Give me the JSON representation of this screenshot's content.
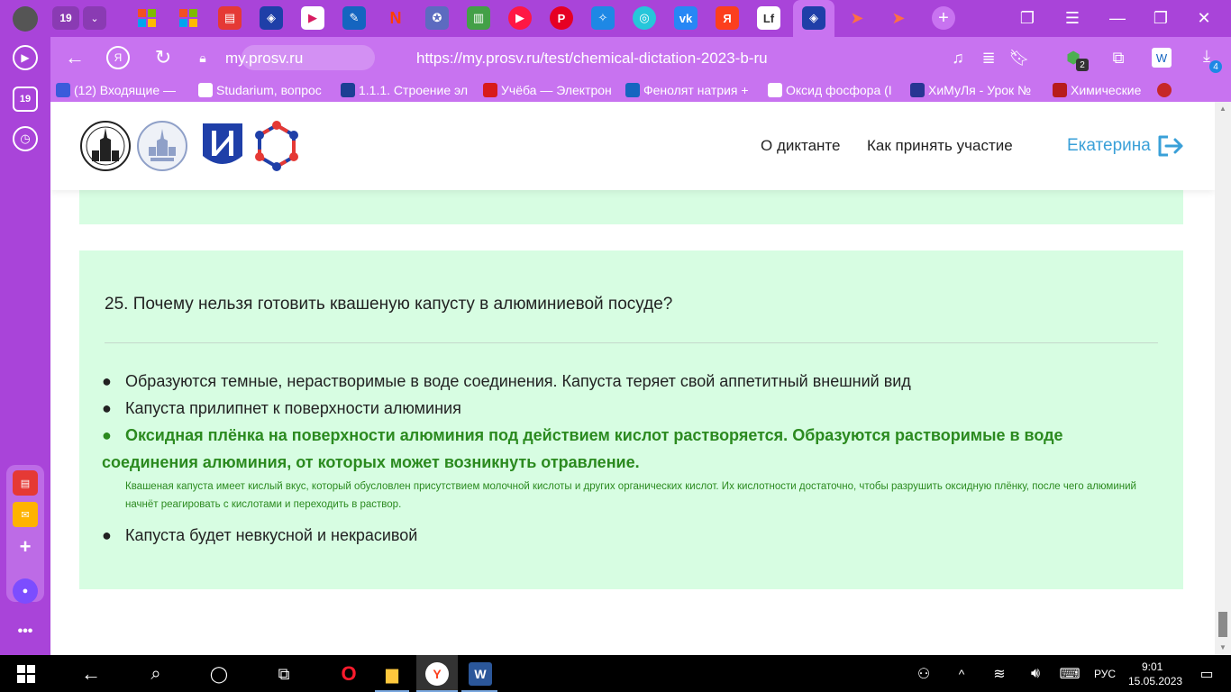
{
  "browser": {
    "tab_counter": "19",
    "sidebar_counter": "19",
    "url_domain": "my.prosv.ru",
    "url_full": "https://my.prosv.ru/test/chemical-dictation-2023-b-ru",
    "badge_downloads": "4",
    "badge_extension": "2",
    "accent_color": "#a944d9",
    "bookmarks": [
      {
        "label": "(12) Входящие — ",
        "icon": "mail-icon",
        "color": "#3b5bdb"
      },
      {
        "label": "Studarium, вопрос",
        "icon": "studarium-icon",
        "color": "#ffffff"
      },
      {
        "label": "1.1.1. Строение эл",
        "icon": "atom-icon",
        "color": "#1c3f94"
      },
      {
        "label": "Учёба — Электрон",
        "icon": "study-icon",
        "color": "#d81b1b"
      },
      {
        "label": "Фенолят натрия +",
        "icon": "ac-icon",
        "color": "#1565c0"
      },
      {
        "label": "Оксид фосфора (I",
        "icon": "dots-icon",
        "color": "#ffffff"
      },
      {
        "label": "ХиМуЛя - Урок №",
        "icon": "himulya-icon",
        "color": "#283593"
      },
      {
        "label": "Химические",
        "icon": "flask-icon",
        "color": "#b71c1c"
      }
    ]
  },
  "site": {
    "nav": {
      "about": "О диктанте",
      "howto": "Как принять участие"
    },
    "user": "Екатерина"
  },
  "question": {
    "title": "25. Почему нельзя готовить квашеную капусту в алюминиевой посуде?",
    "answers": [
      {
        "text": "Образуются темные, нерастворимые в воде соединения. Капуста теряет свой аппетитный внешний вид",
        "correct": false
      },
      {
        "text": "Капуста прилипнет к поверхности алюминия",
        "correct": false
      },
      {
        "text": "Оксидная плёнка на поверхности алюминия под действием кислот растворяется. Образуются растворимые в воде соединения алюминия, от которых может возникнуть отравление.",
        "correct": true
      },
      {
        "text": "Капуста будет невкусной и некрасивой",
        "correct": false
      }
    ],
    "explanation": "Квашеная капуста имеет кислый вкус, который обусловлен присутствием молочной кислоты и других органических кислот. Их кислотности достаточно, чтобы разрушить оксидную плёнку, после чего алюминий начнёт реагировать с кислотами и переходить в раствор.",
    "correct_color": "#2b8a1f",
    "card_color": "#d7fde2"
  },
  "taskbar": {
    "language": "РУС",
    "time": "9:01",
    "date": "15.05.2023"
  }
}
